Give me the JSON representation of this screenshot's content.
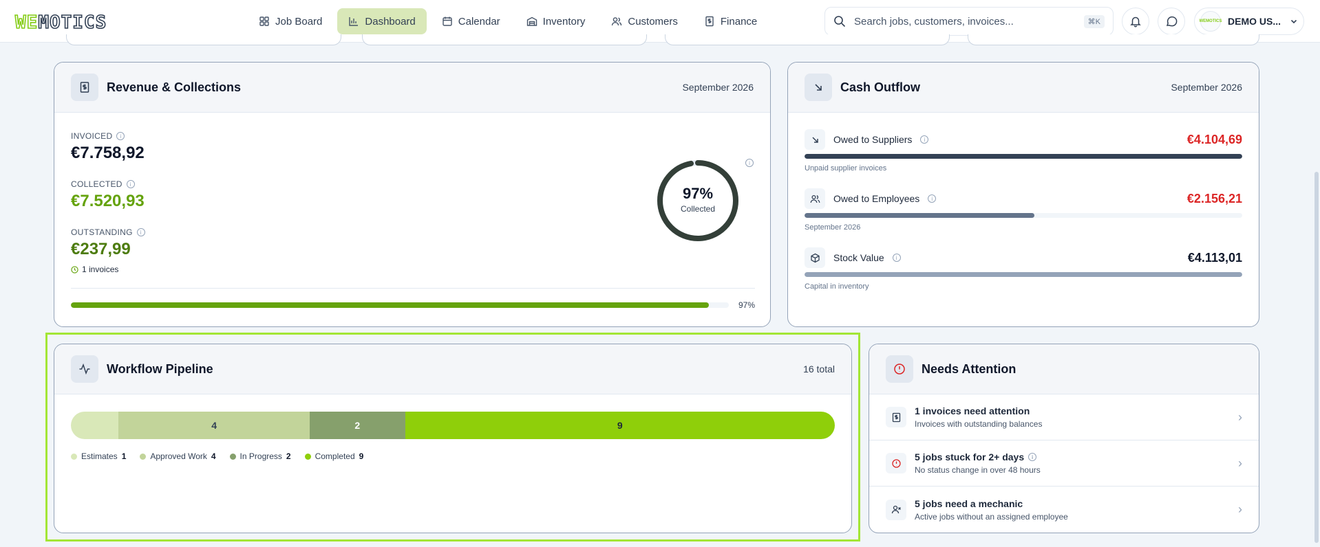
{
  "nav": {
    "logo_we": "WE",
    "logo_rest": "MOTICS",
    "items": [
      {
        "label": "Job Board"
      },
      {
        "label": "Dashboard"
      },
      {
        "label": "Calendar"
      },
      {
        "label": "Inventory"
      },
      {
        "label": "Customers"
      },
      {
        "label": "Finance"
      }
    ],
    "active_index": 1,
    "search_placeholder": "Search jobs, customers, invoices...",
    "search_shortcut": "⌘K",
    "user_name": "DEMO US...",
    "avatar_text": "WEMOTICS"
  },
  "revenue": {
    "title": "Revenue & Collections",
    "period": "September 2026",
    "invoiced_label": "INVOICED",
    "invoiced_value": "€7.758,92",
    "collected_label": "COLLECTED",
    "collected_value": "€7.520,93",
    "outstanding_label": "OUTSTANDING",
    "outstanding_value": "€237,99",
    "outstanding_note": "1 invoices",
    "ring_percent": "97%",
    "ring_label": "Collected",
    "ring_fraction": 0.97,
    "bar_percent": "97%",
    "bar_fraction": 0.97
  },
  "outflow": {
    "title": "Cash Outflow",
    "period": "September 2026",
    "rows": [
      {
        "label": "Owed to Suppliers",
        "value": "€4.104,69",
        "sub": "Unpaid supplier invoices",
        "fraction": 1.0,
        "bar_color": "#334155",
        "value_color": "#dc2626"
      },
      {
        "label": "Owed to Employees",
        "value": "€2.156,21",
        "sub": "September 2026",
        "fraction": 0.525,
        "bar_color": "#64748b",
        "value_color": "#dc2626"
      },
      {
        "label": "Stock Value",
        "value": "€4.113,01",
        "sub": "Capital in inventory",
        "fraction": 1.0,
        "bar_color": "#94a3b8",
        "value_color": "#0f172a"
      }
    ]
  },
  "pipeline": {
    "title": "Workflow Pipeline",
    "total": "16 total",
    "segments": [
      {
        "name": "Estimates",
        "count": 1,
        "color": "#d9e8b8",
        "text_color": "#334155"
      },
      {
        "name": "Approved Work",
        "count": 4,
        "color": "#c2d49a",
        "text_color": "#334155"
      },
      {
        "name": "In Progress",
        "count": 2,
        "color": "#86a06c",
        "text_color": "#ffffff"
      },
      {
        "name": "Completed",
        "count": 9,
        "color": "#8fcf0a",
        "text_color": "#1e293b"
      }
    ]
  },
  "attention": {
    "title": "Needs Attention",
    "items": [
      {
        "title": "1 invoices need attention",
        "sub": "Invoices with outstanding balances",
        "icon": "invoice-icon"
      },
      {
        "title": "5 jobs stuck for 2+ days",
        "sub": "No status change in over 48 hours",
        "icon": "alert-icon"
      },
      {
        "title": "5 jobs need a mechanic",
        "sub": "Active jobs without an assigned employee",
        "icon": "user-x-icon"
      }
    ]
  },
  "colors": {
    "accent": "#84cc16",
    "green_text": "#65a30d",
    "dark_green_text": "#4d7c0f",
    "ring": "#333f38",
    "highlight": "#a3e635"
  }
}
